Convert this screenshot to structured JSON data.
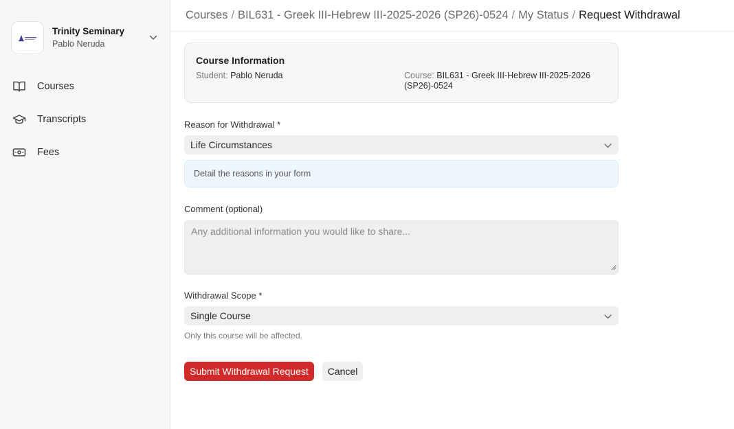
{
  "sidebar": {
    "org_name": "Trinity Seminary",
    "user_name": "Pablo Neruda",
    "logo_icon": "seminary-logo",
    "nav": [
      {
        "label": "Courses",
        "icon": "book-open-icon"
      },
      {
        "label": "Transcripts",
        "icon": "graduation-cap-icon"
      },
      {
        "label": "Fees",
        "icon": "banknote-icon"
      }
    ]
  },
  "breadcrumb": {
    "items": [
      "Courses",
      "BIL631 - Greek III-Hebrew III-2025-2026 (SP26)-0524",
      "My Status"
    ],
    "current": "Request Withdrawal",
    "separator": "/"
  },
  "course_info": {
    "title": "Course Information",
    "student_label": "Student:",
    "student_value": "Pablo Neruda",
    "course_label": "Course:",
    "course_value": "BIL631 - Greek III-Hebrew III-2025-2026 (SP26)-0524"
  },
  "form": {
    "reason_label": "Reason for Withdrawal *",
    "reason_value": "Life Circumstances",
    "reason_hint": "Detail the reasons in your form",
    "comment_label": "Comment (optional)",
    "comment_placeholder": "Any additional information you would like to share...",
    "scope_label": "Withdrawal Scope *",
    "scope_value": "Single Course",
    "scope_hint": "Only this course will be affected."
  },
  "actions": {
    "submit_label": "Submit Withdrawal Request",
    "cancel_label": "Cancel"
  },
  "colors": {
    "primary": "#d12a2a",
    "hint_bg": "#eff7fe",
    "sidebar_bg": "#f7f7f7"
  }
}
